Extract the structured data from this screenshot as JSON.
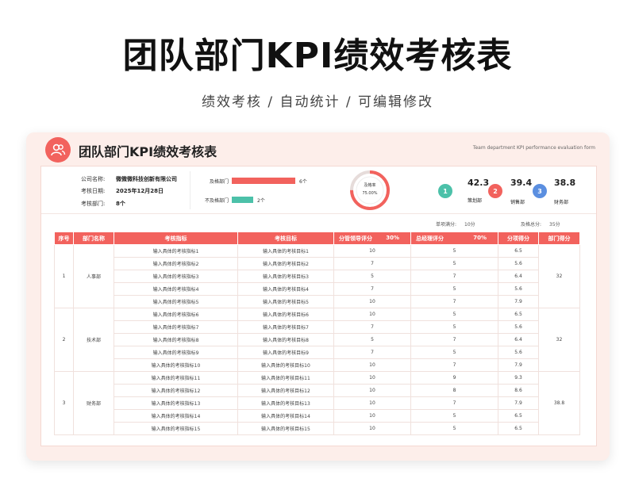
{
  "page_title": "团队部门KPI绩效考核表",
  "subtitle": "绩效考核 / 自动统计 / 可编辑修改",
  "card": {
    "title": "团队部门KPI绩效考核表",
    "title_en": "Team department KPI performance evaluation form"
  },
  "info": {
    "company_label": "公司名称:",
    "company_value": "微微微科技创新有限公司",
    "date_label": "考核日期:",
    "date_value": "2025年12月28日",
    "dept_label": "考核部门:",
    "dept_value": "8个"
  },
  "pass_stats": {
    "pass_label": "及格部门",
    "pass_value": "6个",
    "pass_ratio": 0.75,
    "fail_label": "不及格部门",
    "fail_value": "2个",
    "fail_ratio": 0.25,
    "rate_label": "及格率",
    "rate_value": "75.00%",
    "rate_fraction": 0.75
  },
  "ranking": [
    {
      "rank": "1",
      "score": "42.3",
      "dept": "策划部",
      "color": "#4cc1a9"
    },
    {
      "rank": "2",
      "score": "39.4",
      "dept": "销售部",
      "color": "#f2625d"
    },
    {
      "rank": "3",
      "score": "38.8",
      "dept": "财务部",
      "color": "#5b8fe0"
    }
  ],
  "summary": {
    "single_full_label": "单项满分:",
    "single_full_value": "10分",
    "pass_total_label": "及格总分:",
    "pass_total_value": "35分"
  },
  "table": {
    "headers": {
      "no": "序号",
      "dept": "部门名称",
      "indicator": "考核指标",
      "target": "考核目标",
      "leader_score": "分管领导评分",
      "leader_weight": "30%",
      "gm_score": "总经理评分",
      "gm_weight": "70%",
      "item_score": "分项得分",
      "dept_score": "部门得分"
    },
    "groups": [
      {
        "no": "1",
        "dept": "人事部",
        "dept_score": "32",
        "rows": [
          {
            "indicator": "输入具体的考核指标1",
            "target": "输入具体的考核目标1",
            "leader": "10",
            "gm": "5",
            "item": "6.5"
          },
          {
            "indicator": "输入具体的考核指标2",
            "target": "输入具体的考核目标2",
            "leader": "7",
            "gm": "5",
            "item": "5.6"
          },
          {
            "indicator": "输入具体的考核指标3",
            "target": "输入具体的考核目标3",
            "leader": "5",
            "gm": "7",
            "item": "6.4"
          },
          {
            "indicator": "输入具体的考核指标4",
            "target": "输入具体的考核目标4",
            "leader": "7",
            "gm": "5",
            "item": "5.6"
          },
          {
            "indicator": "输入具体的考核指标5",
            "target": "输入具体的考核目标5",
            "leader": "10",
            "gm": "7",
            "item": "7.9"
          }
        ]
      },
      {
        "no": "2",
        "dept": "技术部",
        "dept_score": "32",
        "rows": [
          {
            "indicator": "输入具体的考核指标6",
            "target": "输入具体的考核目标6",
            "leader": "10",
            "gm": "5",
            "item": "6.5"
          },
          {
            "indicator": "输入具体的考核指标7",
            "target": "输入具体的考核目标7",
            "leader": "7",
            "gm": "5",
            "item": "5.6"
          },
          {
            "indicator": "输入具体的考核指标8",
            "target": "输入具体的考核目标8",
            "leader": "5",
            "gm": "7",
            "item": "6.4"
          },
          {
            "indicator": "输入具体的考核指标9",
            "target": "输入具体的考核目标9",
            "leader": "7",
            "gm": "5",
            "item": "5.6"
          },
          {
            "indicator": "输入具体的考核指标10",
            "target": "输入具体的考核目标10",
            "leader": "10",
            "gm": "7",
            "item": "7.9"
          }
        ]
      },
      {
        "no": "3",
        "dept": "财务部",
        "dept_score": "38.8",
        "rows": [
          {
            "indicator": "输入具体的考核指标11",
            "target": "输入具体的考核目标11",
            "leader": "10",
            "gm": "9",
            "item": "9.3"
          },
          {
            "indicator": "输入具体的考核指标12",
            "target": "输入具体的考核目标12",
            "leader": "10",
            "gm": "8",
            "item": "8.6"
          },
          {
            "indicator": "输入具体的考核指标13",
            "target": "输入具体的考核目标13",
            "leader": "10",
            "gm": "7",
            "item": "7.9"
          },
          {
            "indicator": "输入具体的考核指标14",
            "target": "输入具体的考核目标14",
            "leader": "10",
            "gm": "5",
            "item": "6.5"
          },
          {
            "indicator": "输入具体的考核指标15",
            "target": "输入具体的考核目标15",
            "leader": "10",
            "gm": "5",
            "item": "6.5"
          }
        ]
      }
    ]
  },
  "colors": {
    "accent": "#f2625d",
    "teal": "#4cc1a9",
    "blue": "#5b8fe0",
    "card_bg": "#fdeeea"
  }
}
